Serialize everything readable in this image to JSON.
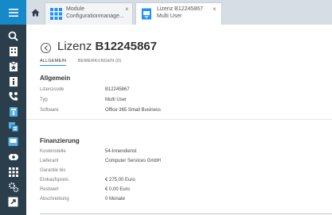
{
  "tabs": [
    {
      "line1": "Module",
      "line2": "Configurationmanage...",
      "close": "×"
    },
    {
      "line1": "Lizenz B12245867",
      "line2": "Multi User",
      "close": "×"
    }
  ],
  "page": {
    "title_prefix": "Lizenz",
    "title_id": "B12245867"
  },
  "subtabs": [
    {
      "label": "ALLGEMEIN"
    },
    {
      "label": "BEMERKUNGEN (0)"
    }
  ],
  "allgemein": {
    "heading": "Allgemein",
    "rows": [
      {
        "label": "Lizenzcode",
        "value": "B12245867"
      },
      {
        "label": "Typ",
        "value": "Multi User"
      },
      {
        "label": "Software",
        "value": "Office 365 Small Business"
      }
    ]
  },
  "finanzierung": {
    "heading": "Finanzierung",
    "rows": [
      {
        "label": "Kostenstelle",
        "value": "54-Innendienst"
      },
      {
        "label": "Lieferant",
        "value": "Computer Services GmbH"
      },
      {
        "label": "Garantie bis",
        "value": ""
      },
      {
        "label": "Einkaufspreis",
        "value": "€ 275,00   Euro"
      },
      {
        "label": "Restwert",
        "value": "€ 0,00   Euro"
      },
      {
        "label": "Abschreibung",
        "value": "0   Monate"
      }
    ]
  },
  "colors": {
    "sidebar": "#2b3e4c",
    "menu_active": "#1689c9",
    "accent": "#1e90ff"
  }
}
